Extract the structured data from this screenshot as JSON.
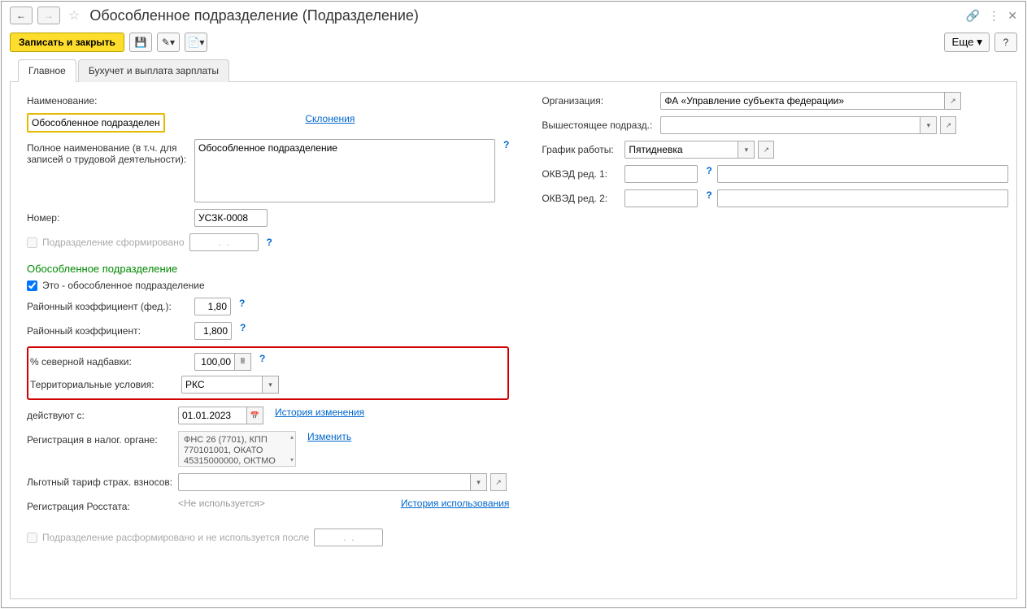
{
  "title": "Обособленное подразделение (Подразделение)",
  "toolbar": {
    "save_close": "Записать и закрыть",
    "more": "Еще"
  },
  "tabs": {
    "main": "Главное",
    "accounting": "Бухучет и выплата зарплаты"
  },
  "left": {
    "name_label": "Наименование:",
    "name_value": "Обособленное подразделение",
    "declensions": "Склонения",
    "fullname_label": "Полное наименование (в т.ч. для записей о трудовой деятельности):",
    "fullname_value": "Обособленное подразделение",
    "number_label": "Номер:",
    "number_value": "УСЗК-0008",
    "formed_label": "Подразделение сформировано",
    "formed_date": ".  .",
    "section_title": "Обособленное подразделение",
    "is_separate_label": "Это - обособленное подразделение",
    "coef_fed_label": "Районный коэффициент (фед.):",
    "coef_fed_value": "1,80",
    "coef_label": "Районный коэффициент:",
    "coef_value": "1,800",
    "north_pct_label": "% северной надбавки:",
    "north_pct_value": "100,00",
    "terr_label": "Территориальные условия:",
    "terr_value": "РКС",
    "valid_from_label": "действуют с:",
    "valid_from_value": "01.01.2023",
    "history_link": "История изменения",
    "tax_reg_label": "Регистрация в налог. органе:",
    "tax_reg_value": "ФНС 26 (7701), КПП 770101001, ОКАТО 45315000000, ОКТМО",
    "change_link": "Изменить",
    "tarif_label": "Льготный тариф страх. взносов:",
    "rosstat_label": "Регистрация Росстата:",
    "rosstat_value": "<Не используется>",
    "usage_history": "История использования",
    "disbanded_label": "Подразделение расформировано и не используется после",
    "disbanded_date": ".  ."
  },
  "right": {
    "org_label": "Организация:",
    "org_value": "ФА «Управление субъекта федерации»",
    "parent_label": "Вышестоящее подразд.:",
    "schedule_label": "График работы:",
    "schedule_value": "Пятидневка",
    "okved1_label": "ОКВЭД ред. 1:",
    "okved2_label": "ОКВЭД ред. 2:"
  }
}
